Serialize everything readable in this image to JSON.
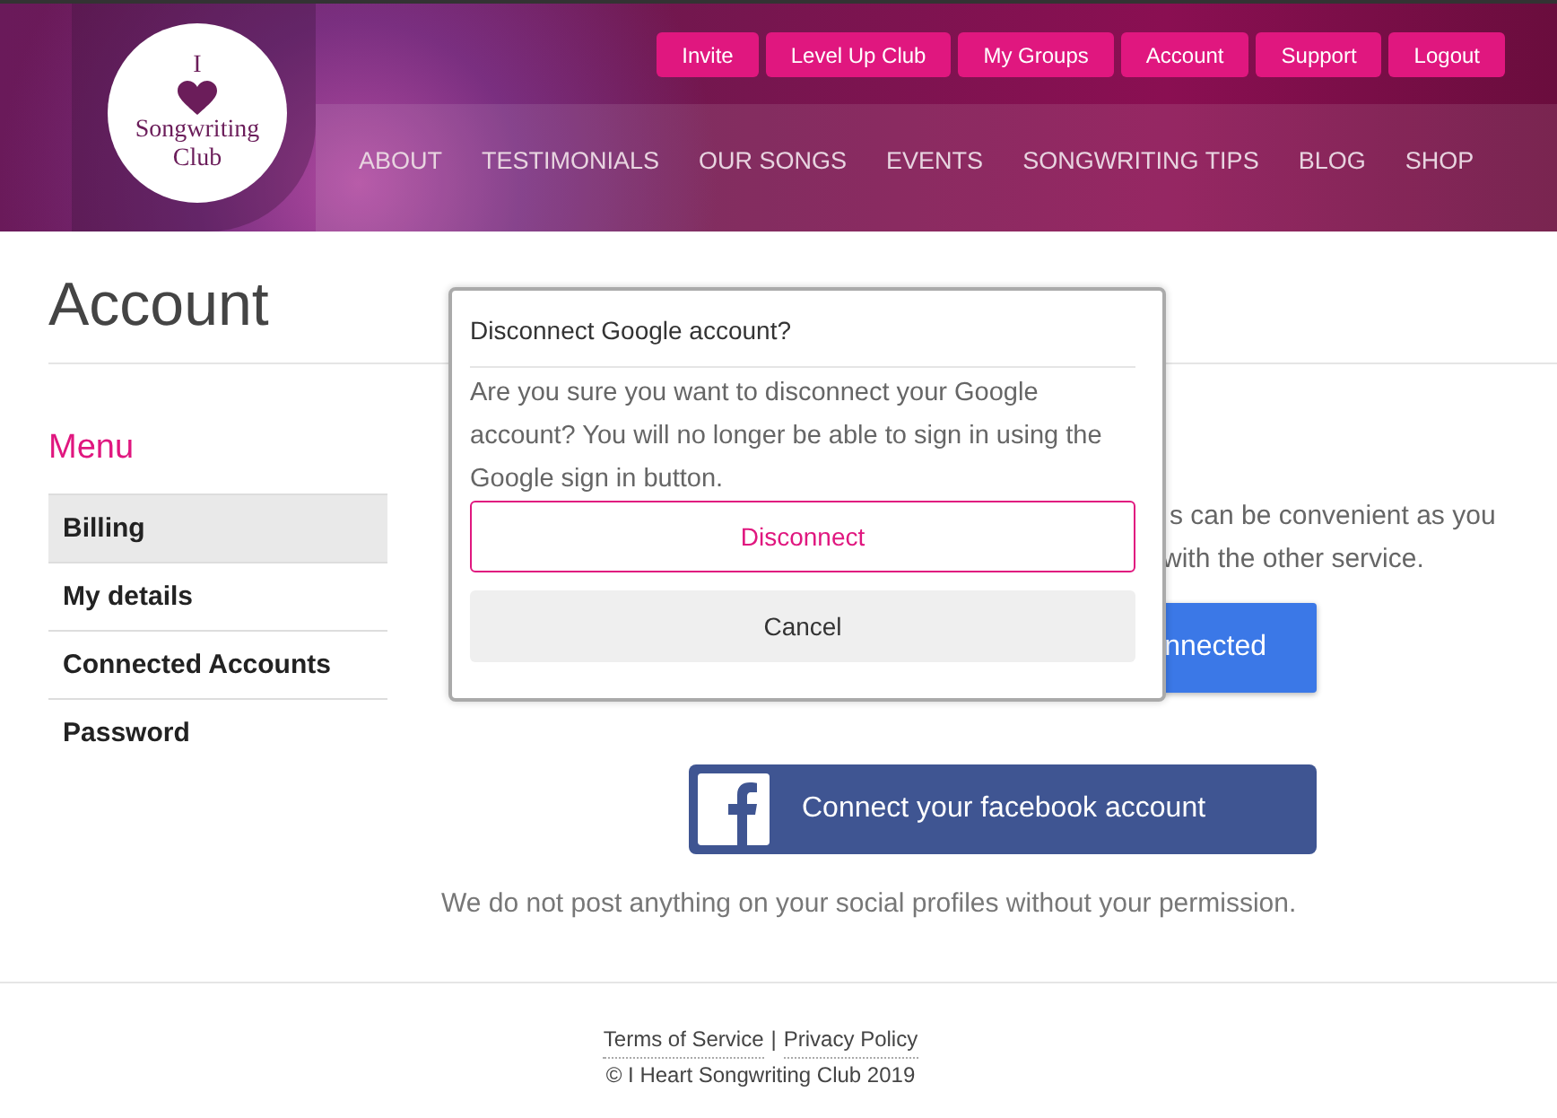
{
  "header": {
    "logo": {
      "top": "I",
      "bottom": "Songwriting Club"
    },
    "top_buttons": [
      "Invite",
      "Level Up Club",
      "My Groups",
      "Account",
      "Support",
      "Logout"
    ],
    "nav": [
      "ABOUT",
      "TESTIMONIALS",
      "OUR SONGS",
      "EVENTS",
      "SONGWRITING TIPS",
      "BLOG",
      "SHOP"
    ]
  },
  "page_title": "Account",
  "sidebar": {
    "title": "Menu",
    "items": [
      {
        "label": "Billing",
        "selected": true
      },
      {
        "label": "My details",
        "selected": false
      },
      {
        "label": "Connected Accounts",
        "selected": false
      },
      {
        "label": "Password",
        "selected": false
      }
    ]
  },
  "main": {
    "paragraph_lines": [
      "s can be convenient as you",
      "with the other service."
    ],
    "google_button": "nnected",
    "facebook_button": "Connect your facebook account",
    "note": "We do not post anything on your social profiles without your permission."
  },
  "dialog": {
    "title": "Disconnect Google account?",
    "body": "Are you sure you want to disconnect your Google account? You will no longer be able to sign in using the Google sign in button.",
    "confirm": "Disconnect",
    "cancel": "Cancel"
  },
  "footer": {
    "links": [
      "Terms of Service",
      "Privacy Policy"
    ],
    "separator": "|",
    "copyright": "© I Heart Songwriting Club 2019"
  }
}
